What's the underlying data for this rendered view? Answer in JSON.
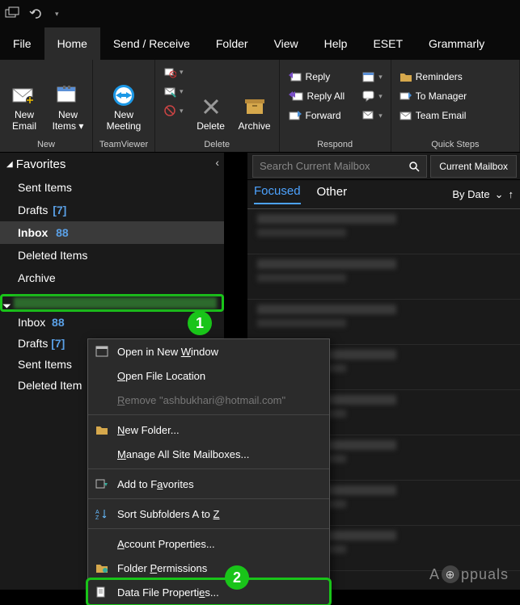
{
  "titlebar": {
    "undo_tip": "Undo"
  },
  "tabs": {
    "file": "File",
    "home": "Home",
    "send_receive": "Send / Receive",
    "folder": "Folder",
    "view": "View",
    "help": "Help",
    "eset": "ESET",
    "grammarly": "Grammarly"
  },
  "ribbon": {
    "new": {
      "label": "New",
      "new_email_l1": "New",
      "new_email_l2": "Email",
      "new_items_l1": "New",
      "new_items_l2": "Items"
    },
    "teamviewer": {
      "label": "TeamViewer",
      "new_meeting_l1": "New",
      "new_meeting_l2": "Meeting"
    },
    "delete": {
      "label": "Delete",
      "delete_btn": "Delete",
      "archive_btn": "Archive"
    },
    "respond": {
      "label": "Respond",
      "reply": "Reply",
      "reply_all": "Reply All",
      "forward": "Forward"
    },
    "quicksteps": {
      "label": "Quick Steps",
      "reminders": "Reminders",
      "to_manager": "To Manager",
      "team_email": "Team Email"
    }
  },
  "sidebar": {
    "favorites": "Favorites",
    "items": [
      {
        "label": "Sent Items"
      },
      {
        "label": "Drafts",
        "count": "[7]"
      },
      {
        "label": "Inbox",
        "count": "88",
        "selected": true
      },
      {
        "label": "Deleted Items"
      },
      {
        "label": "Archive"
      }
    ],
    "sub": [
      {
        "label": "Inbox",
        "count": "88"
      },
      {
        "label": "Drafts",
        "count": "[7]"
      },
      {
        "label": "Sent Items"
      },
      {
        "label": "Deleted Item"
      }
    ]
  },
  "mail": {
    "search_placeholder": "Search Current Mailbox",
    "scope": "Current Mailbox",
    "tab_focused": "Focused",
    "tab_other": "Other",
    "sort": "By Date"
  },
  "ctx": {
    "open_new_window": "Open in New Window",
    "open_file_location": "Open File Location",
    "remove": "Remove \"ashbukhari@hotmail.com\"",
    "new_folder": "New Folder...",
    "manage_mailboxes": "Manage All Site Mailboxes...",
    "add_to_favorites": "Add to Favorites",
    "sort_az": "Sort Subfolders A to Z",
    "account_properties": "Account Properties...",
    "folder_permissions": "Folder Permissions",
    "data_file_properties": "Data File Properties..."
  },
  "callouts": {
    "one": "1",
    "two": "2"
  },
  "watermark": {
    "text_a": "A",
    "text_b": "ppuals"
  }
}
